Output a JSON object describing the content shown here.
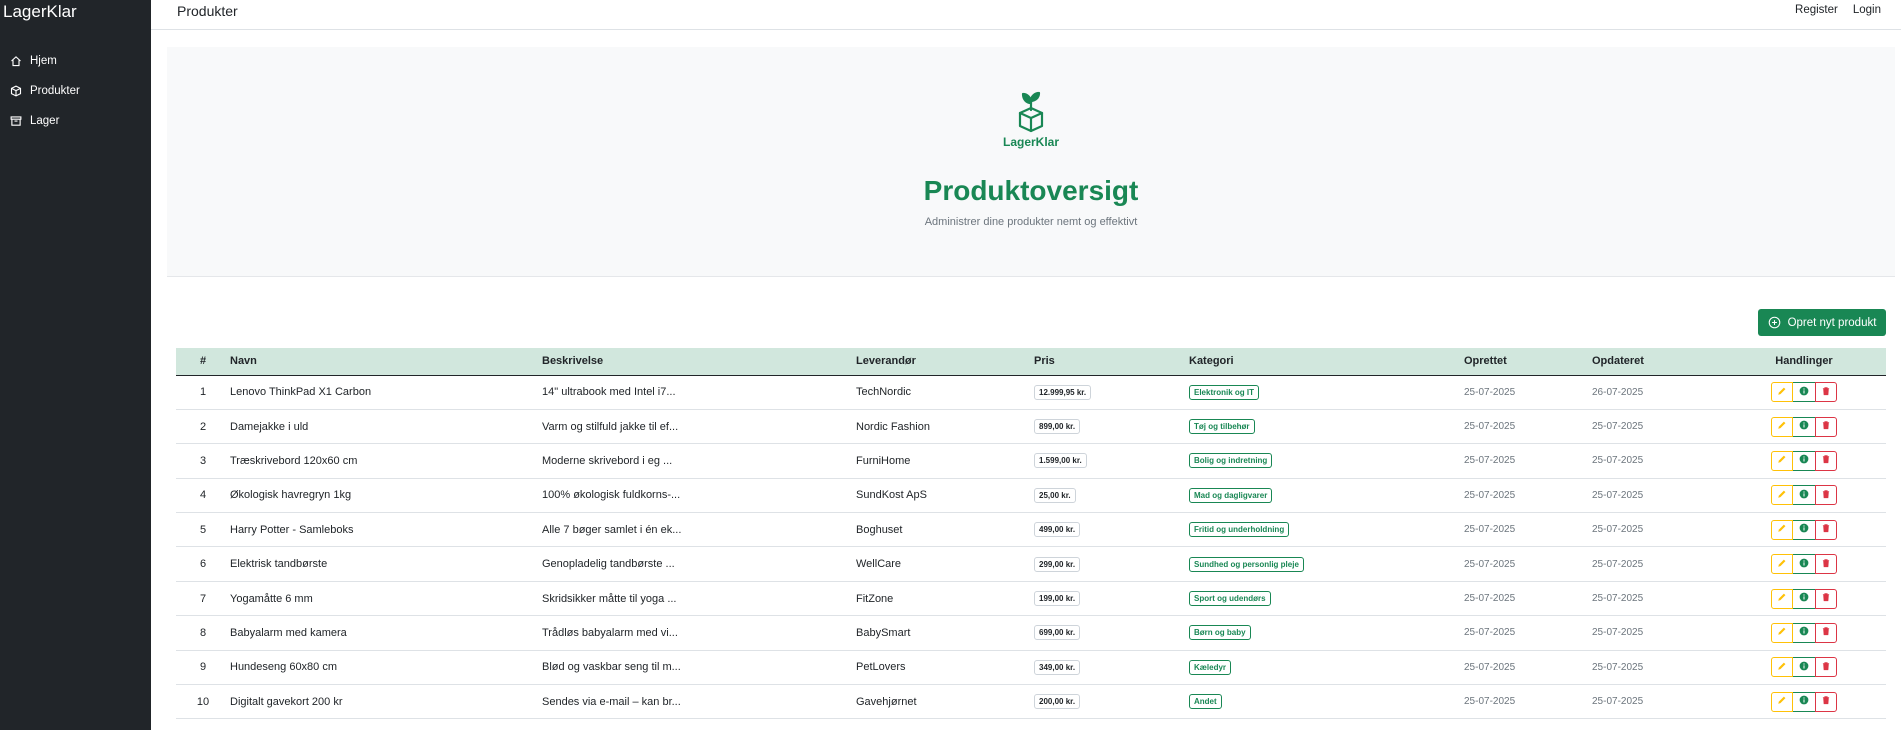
{
  "sidebar": {
    "brand": "LagerKlar",
    "items": [
      {
        "label": "Hjem",
        "icon": "home-icon"
      },
      {
        "label": "Produkter",
        "icon": "box-icon"
      },
      {
        "label": "Lager",
        "icon": "archive-icon"
      }
    ]
  },
  "topbar": {
    "title": "Produkter",
    "register": "Register",
    "login": "Login"
  },
  "hero": {
    "logo_text": "LagerKlar",
    "title": "Produktoversigt",
    "subtitle": "Administrer dine produkter nemt og effektivt"
  },
  "create_button": "Opret nyt produkt",
  "table": {
    "headers": {
      "num": "#",
      "name": "Navn",
      "description": "Beskrivelse",
      "supplier": "Leverandør",
      "price": "Pris",
      "category": "Kategori",
      "created": "Oprettet",
      "updated": "Opdateret",
      "actions": "Handlinger"
    },
    "rows": [
      {
        "num": "1",
        "name": "Lenovo ThinkPad X1 Carbon",
        "description": "14\" ultrabook med Intel i7...",
        "supplier": "TechNordic",
        "price": "12.999,95 kr.",
        "category": "Elektronik og IT",
        "created": "25-07-2025",
        "updated": "26-07-2025"
      },
      {
        "num": "2",
        "name": "Damejakke i uld",
        "description": "Varm og stilfuld jakke til ef...",
        "supplier": "Nordic Fashion",
        "price": "899,00 kr.",
        "category": "Tøj og tilbehør",
        "created": "25-07-2025",
        "updated": "25-07-2025"
      },
      {
        "num": "3",
        "name": "Træskrivebord 120x60 cm",
        "description": "Moderne skrivebord i eg ...",
        "supplier": "FurniHome",
        "price": "1.599,00 kr.",
        "category": "Bolig og indretning",
        "created": "25-07-2025",
        "updated": "25-07-2025"
      },
      {
        "num": "4",
        "name": "Økologisk havregryn 1kg",
        "description": "100% økologisk fuldkorns-...",
        "supplier": "SundKost ApS",
        "price": "25,00 kr.",
        "category": "Mad og dagligvarer",
        "created": "25-07-2025",
        "updated": "25-07-2025"
      },
      {
        "num": "5",
        "name": "Harry Potter - Samleboks",
        "description": "Alle 7 bøger samlet i én ek...",
        "supplier": "Boghuset",
        "price": "499,00 kr.",
        "category": "Fritid og underholdning",
        "created": "25-07-2025",
        "updated": "25-07-2025"
      },
      {
        "num": "6",
        "name": "Elektrisk tandbørste",
        "description": "Genopladelig tandbørste ...",
        "supplier": "WellCare",
        "price": "299,00 kr.",
        "category": "Sundhed og personlig pleje",
        "created": "25-07-2025",
        "updated": "25-07-2025"
      },
      {
        "num": "7",
        "name": "Yogamåtte 6 mm",
        "description": "Skridsikker måtte til yoga ...",
        "supplier": "FitZone",
        "price": "199,00 kr.",
        "category": "Sport og udendørs",
        "created": "25-07-2025",
        "updated": "25-07-2025"
      },
      {
        "num": "8",
        "name": "Babyalarm med kamera",
        "description": "Trådløs babyalarm med vi...",
        "supplier": "BabySmart",
        "price": "699,00 kr.",
        "category": "Børn og baby",
        "created": "25-07-2025",
        "updated": "25-07-2025"
      },
      {
        "num": "9",
        "name": "Hundeseng 60x80 cm",
        "description": "Blød og vaskbar seng til m...",
        "supplier": "PetLovers",
        "price": "349,00 kr.",
        "category": "Kæledyr",
        "created": "25-07-2025",
        "updated": "25-07-2025"
      },
      {
        "num": "10",
        "name": "Digitalt gavekort 200 kr",
        "description": "Sendes via e-mail – kan br...",
        "supplier": "Gavehjørnet",
        "price": "200,00 kr.",
        "category": "Andet",
        "created": "25-07-2025",
        "updated": "25-07-2025"
      }
    ]
  },
  "colors": {
    "sidebar_bg": "#212529",
    "primary_green": "#198754",
    "table_header_bg": "#d1e7dd",
    "warning": "#ffc107",
    "danger": "#dc3545"
  }
}
